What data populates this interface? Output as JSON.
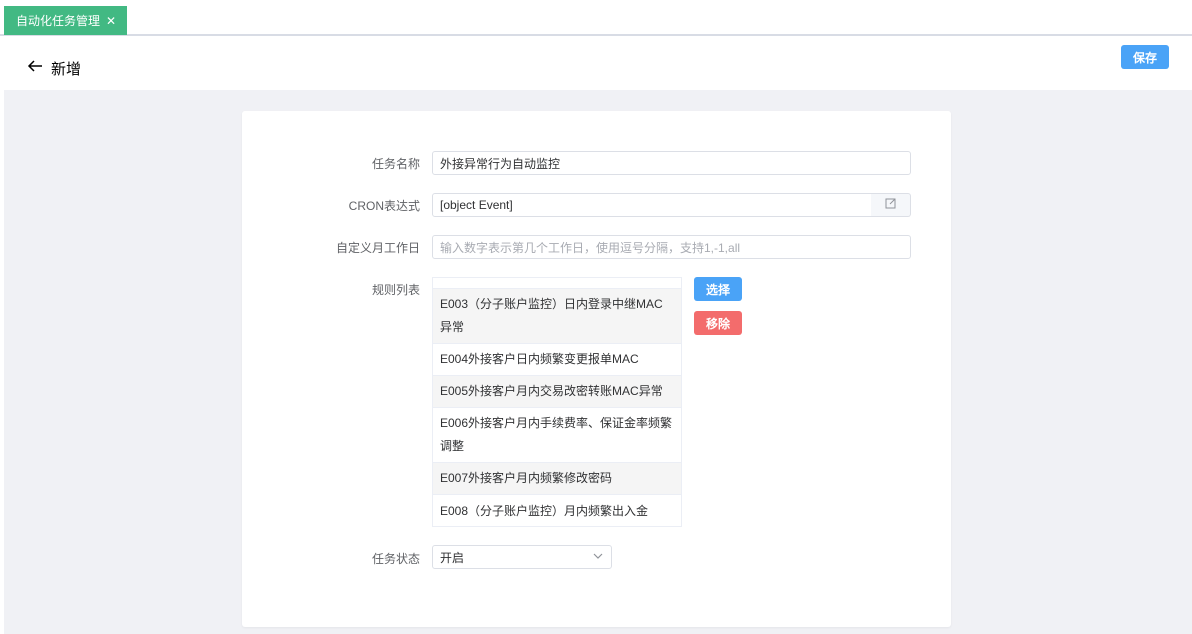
{
  "tabs": [
    {
      "label": "自动化任务管理"
    }
  ],
  "header": {
    "title": "新增",
    "save_label": "保存"
  },
  "form": {
    "name_label": "任务名称",
    "name_value": "外接异常行为自动监控",
    "cron_label": "CRON表达式",
    "cron_value": "[object Event]",
    "workday_label": "自定义月工作日",
    "workday_placeholder": "输入数字表示第几个工作日，使用逗号分隔，支持1,-1,all",
    "rules_label": "规则列表",
    "rules": [
      "E003（分子账户监控）日内登录中继MAC异常",
      "E004外接客户日内频繁变更报单MAC",
      "E005外接客户月内交易改密转账MAC异常",
      "E006外接客户月内手续费率、保证金率频繁调整",
      "E007外接客户月内频繁修改密码",
      "E008（分子账户监控）月内频繁出入金"
    ],
    "select_label": "选择",
    "remove_label": "移除",
    "status_label": "任务状态",
    "status_value": "开启"
  },
  "icons": {
    "back": "arrow-left-icon",
    "edit": "edit-icon",
    "dropdown": "chevron-down-icon",
    "close": "close-icon"
  },
  "colors": {
    "tab": "#42b983",
    "primary": "#4aa3f7",
    "danger": "#f36c6c"
  }
}
